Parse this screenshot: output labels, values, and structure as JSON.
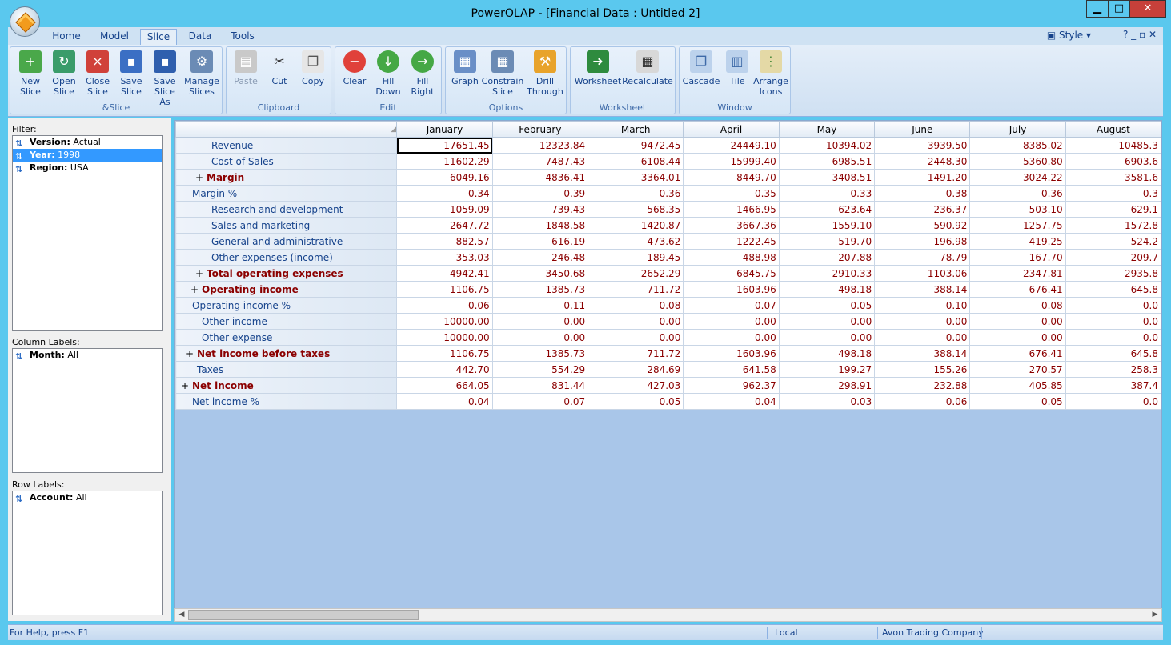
{
  "window": {
    "title": "PowerOLAP - [Financial Data : Untitled 2]",
    "min_glyph": "▁",
    "max_glyph": "□",
    "close_glyph": "✕"
  },
  "tabs": [
    "Home",
    "Model",
    "Slice",
    "Data",
    "Tools"
  ],
  "active_tab": "Slice",
  "style_label": "Style",
  "help_icons": "? _ ▫ ✕",
  "ribbon": {
    "groups": [
      {
        "label": "&Slice",
        "buttons": [
          "New Slice",
          "Open Slice",
          "Close Slice",
          "Save Slice",
          "Save Slice As",
          "Manage Slices"
        ]
      },
      {
        "label": "Clipboard",
        "buttons": [
          "Paste",
          "Cut",
          "Copy"
        ]
      },
      {
        "label": "Edit",
        "buttons": [
          "Clear",
          "Fill Down",
          "Fill Right"
        ]
      },
      {
        "label": "Options",
        "buttons": [
          "Graph",
          "Constrain Slice",
          "Drill Through"
        ]
      },
      {
        "label": "Worksheet",
        "buttons": [
          "Worksheet",
          "Recalculate"
        ]
      },
      {
        "label": "Window",
        "buttons": [
          "Cascade",
          "Tile",
          "Arrange Icons"
        ]
      }
    ]
  },
  "filter": {
    "label": "Filter:",
    "items": [
      {
        "dim": "Version:",
        "value": "Actual"
      },
      {
        "dim": "Year:",
        "value": "1998"
      },
      {
        "dim": "Region:",
        "value": "USA"
      }
    ]
  },
  "column_labels": {
    "label": "Column Labels:",
    "items": [
      {
        "dim": "Month:",
        "value": "All"
      }
    ]
  },
  "row_labels": {
    "label": "Row Labels:",
    "items": [
      {
        "dim": "Account:",
        "value": "All"
      }
    ]
  },
  "grid": {
    "columns": [
      "January",
      "February",
      "March",
      "April",
      "May",
      "June",
      "July",
      "August"
    ],
    "rows": [
      {
        "label": "Revenue",
        "values": [
          "17651.45",
          "12323.84",
          "9472.45",
          "24449.10",
          "10394.02",
          "3939.50",
          "8385.02",
          "10485.3"
        ]
      },
      {
        "label": "Cost of Sales",
        "values": [
          "11602.29",
          "7487.43",
          "6108.44",
          "15999.40",
          "6985.51",
          "2448.30",
          "5360.80",
          "6903.6"
        ]
      },
      {
        "label": "Margin",
        "values": [
          "6049.16",
          "4836.41",
          "3364.01",
          "8449.70",
          "3408.51",
          "1491.20",
          "3024.22",
          "3581.6"
        ]
      },
      {
        "label": "Margin %",
        "values": [
          "0.34",
          "0.39",
          "0.36",
          "0.35",
          "0.33",
          "0.38",
          "0.36",
          "0.3"
        ]
      },
      {
        "label": "Research and development",
        "values": [
          "1059.09",
          "739.43",
          "568.35",
          "1466.95",
          "623.64",
          "236.37",
          "503.10",
          "629.1"
        ]
      },
      {
        "label": "Sales and marketing",
        "values": [
          "2647.72",
          "1848.58",
          "1420.87",
          "3667.36",
          "1559.10",
          "590.92",
          "1257.75",
          "1572.8"
        ]
      },
      {
        "label": "General and administrative",
        "values": [
          "882.57",
          "616.19",
          "473.62",
          "1222.45",
          "519.70",
          "196.98",
          "419.25",
          "524.2"
        ]
      },
      {
        "label": "Other expenses (income)",
        "values": [
          "353.03",
          "246.48",
          "189.45",
          "488.98",
          "207.88",
          "78.79",
          "167.70",
          "209.7"
        ]
      },
      {
        "label": "Total operating expenses",
        "values": [
          "4942.41",
          "3450.68",
          "2652.29",
          "6845.75",
          "2910.33",
          "1103.06",
          "2347.81",
          "2935.8"
        ]
      },
      {
        "label": "Operating income",
        "values": [
          "1106.75",
          "1385.73",
          "711.72",
          "1603.96",
          "498.18",
          "388.14",
          "676.41",
          "645.8"
        ]
      },
      {
        "label": "Operating income %",
        "values": [
          "0.06",
          "0.11",
          "0.08",
          "0.07",
          "0.05",
          "0.10",
          "0.08",
          "0.0"
        ]
      },
      {
        "label": "Other income",
        "values": [
          "10000.00",
          "0.00",
          "0.00",
          "0.00",
          "0.00",
          "0.00",
          "0.00",
          "0.0"
        ]
      },
      {
        "label": "Other expense",
        "values": [
          "10000.00",
          "0.00",
          "0.00",
          "0.00",
          "0.00",
          "0.00",
          "0.00",
          "0.0"
        ]
      },
      {
        "label": "Net income before taxes",
        "values": [
          "1106.75",
          "1385.73",
          "711.72",
          "1603.96",
          "498.18",
          "388.14",
          "676.41",
          "645.8"
        ]
      },
      {
        "label": "Taxes",
        "values": [
          "442.70",
          "554.29",
          "284.69",
          "641.58",
          "199.27",
          "155.26",
          "270.57",
          "258.3"
        ]
      },
      {
        "label": "Net income",
        "values": [
          "664.05",
          "831.44",
          "427.03",
          "962.37",
          "298.91",
          "232.88",
          "405.85",
          "387.4"
        ]
      },
      {
        "label": "Net income %",
        "values": [
          "0.04",
          "0.07",
          "0.05",
          "0.04",
          "0.03",
          "0.06",
          "0.05",
          "0.0"
        ]
      }
    ]
  },
  "status": {
    "help": "For Help, press F1",
    "mode": "Local",
    "company": "Avon Trading Company"
  },
  "colors": {
    "accent": "#5ac8ee",
    "value_text": "#8b0000",
    "label_text": "#15428b",
    "selection": "#3399ff"
  }
}
